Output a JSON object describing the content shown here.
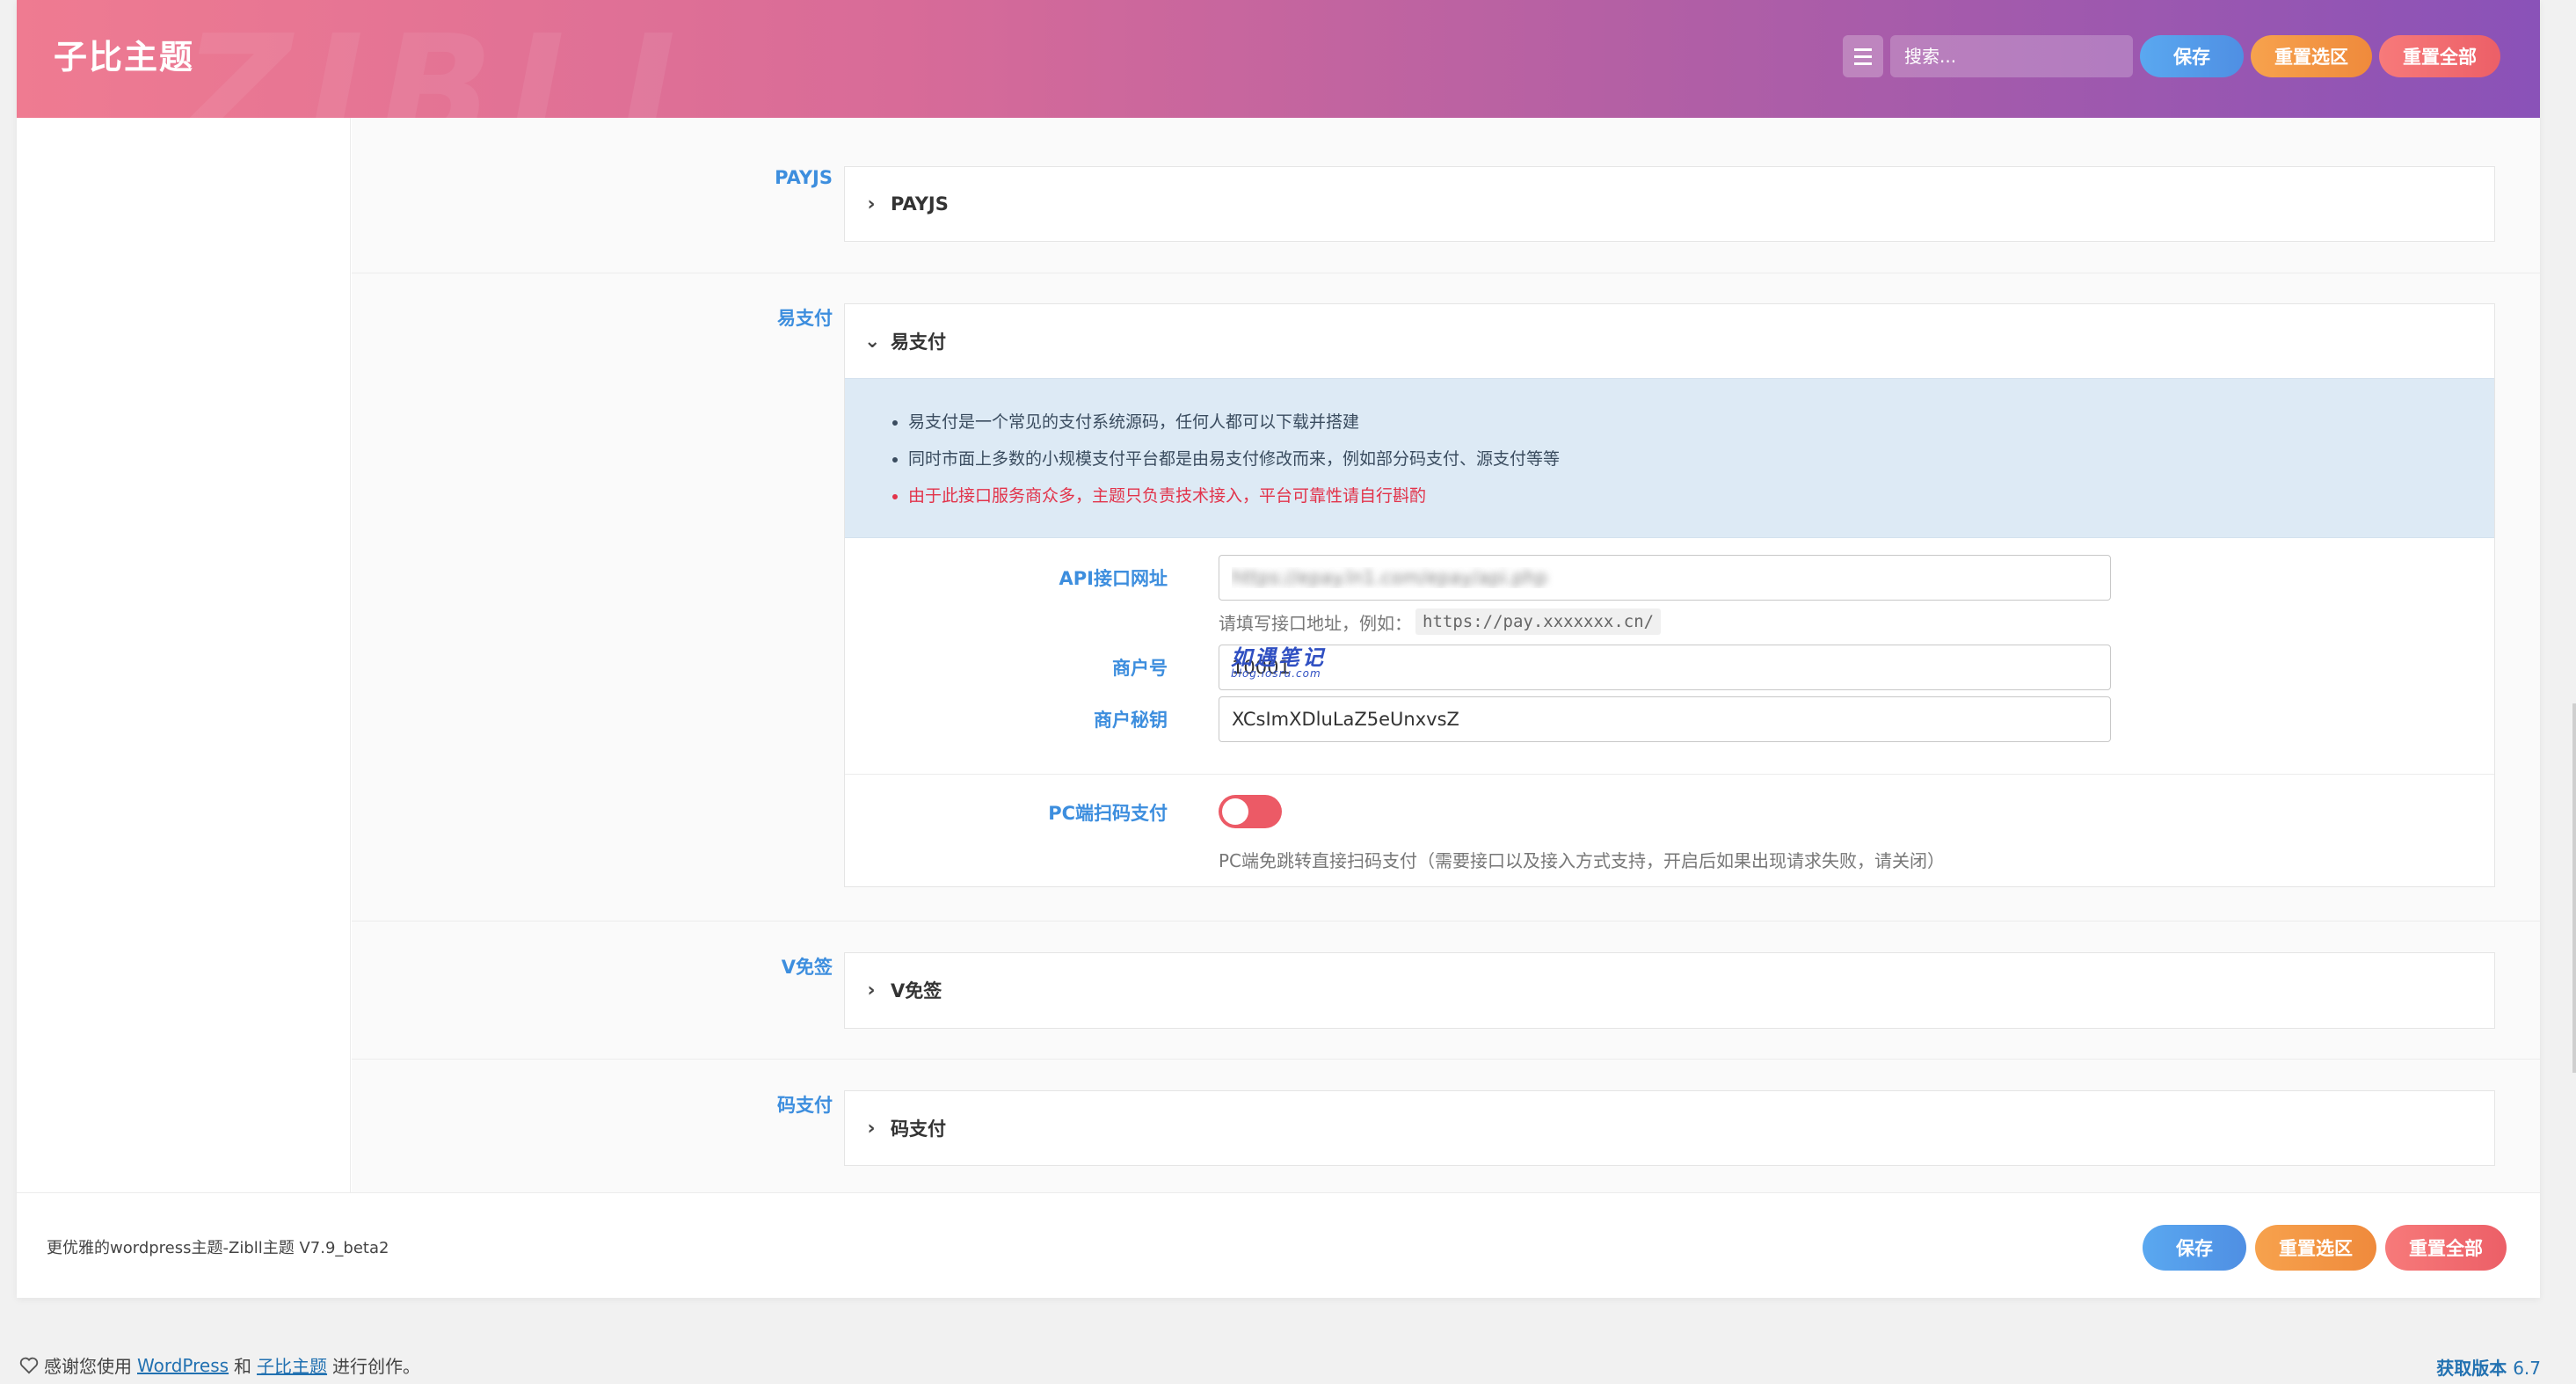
{
  "header": {
    "title": "子比主题",
    "ghost_text": "ZIBLL",
    "search_placeholder": "搜索...",
    "save_label": "保存",
    "reset_section_label": "重置选区",
    "reset_all_label": "重置全部",
    "menu_icon": "list-icon"
  },
  "sections": [
    {
      "label": "PAYJS",
      "panel_title": "PAYJS",
      "expanded": false
    },
    {
      "label": "易支付",
      "panel_title": "易支付",
      "expanded": true,
      "notices": [
        "易支付是一个常见的支付系统源码，任何人都可以下载并搭建",
        "同时市面上多数的小规模支付平台都是由易支付修改而来，例如部分码支付、源支付等等",
        "由于此接口服务商众多，主题只负责技术接入，平台可靠性请自行斟酌"
      ],
      "fields": {
        "api_label": "API接口网址",
        "api_value": "https://epay.ln1.com/epay/api.php",
        "api_hint": "请填写接口地址，例如：",
        "api_hint_code": "https://pay.xxxxxxx.cn/",
        "merchant_id_label": "商户号",
        "merchant_id_value": "10001",
        "merchant_key_label": "商户秘钥",
        "merchant_key_value": "XCsImXDluLaZ5eUnxvsZ",
        "pc_qr_label": "PC端扫码支付",
        "pc_qr_enabled": true,
        "pc_qr_hint": "PC端免跳转直接扫码支付（需要接口以及接入方式支持，开启后如果出现请求失败，请关闭）"
      },
      "watermark": "如遇笔记",
      "watermark_url": "blog.iosru.com"
    },
    {
      "label": "V免签",
      "panel_title": "V免签",
      "expanded": false
    },
    {
      "label": "码支付",
      "panel_title": "码支付",
      "expanded": false
    }
  ],
  "footer": {
    "version_text": "更优雅的wordpress主题-Zibll主题 V7.9_beta2",
    "save_label": "保存",
    "reset_section_label": "重置选区",
    "reset_all_label": "重置全部"
  },
  "page_foot": {
    "prefix": "感谢您使用",
    "link1": "WordPress",
    "mid": "和",
    "link2": "子比主题",
    "suffix": "进行创作。",
    "version_label": "获取版本",
    "version_number": "6.7"
  },
  "colors": {
    "accent_blue": "#3d8ede",
    "warn_red": "#e2334a",
    "toggle_on": "#ec5a66",
    "notice_bg": "#ddeaf5"
  }
}
